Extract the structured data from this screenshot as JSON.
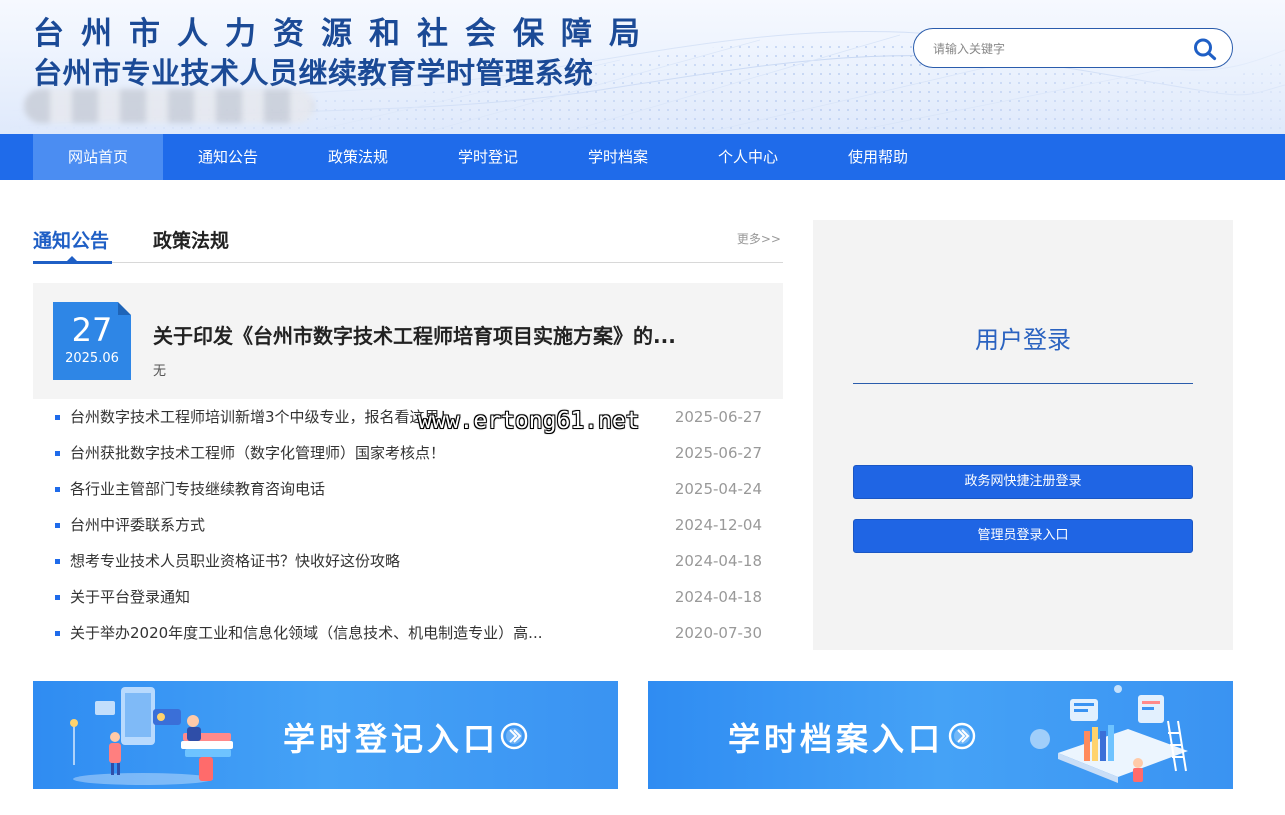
{
  "header": {
    "title_line1": "台州市人力资源和社会保障局",
    "title_line2": "台州市专业技术人员继续教育学时管理系统",
    "search_placeholder": "请输入关键字",
    "search_icon": "search-icon"
  },
  "nav": {
    "items": [
      {
        "label": "网站首页",
        "active": true
      },
      {
        "label": "通知公告"
      },
      {
        "label": "政策法规"
      },
      {
        "label": "学时登记"
      },
      {
        "label": "学时档案"
      },
      {
        "label": "个人中心"
      },
      {
        "label": "使用帮助"
      }
    ]
  },
  "news": {
    "tabs": [
      "通知公告",
      "政策法规"
    ],
    "more": "更多>>",
    "featured": {
      "day": "27",
      "year_month": "2025.06",
      "title": "关于印发《台州市数字技术工程师培育项目实施方案》的...",
      "subtitle": "无"
    },
    "items": [
      {
        "title": "台州数字技术工程师培训新增3个中级专业，报名看这里！",
        "date": "2025-06-27"
      },
      {
        "title": "台州获批数字技术工程师（数字化管理师）国家考核点！",
        "date": "2025-06-27"
      },
      {
        "title": "各行业主管部门专技继续教育咨询电话",
        "date": "2025-04-24"
      },
      {
        "title": "台州中评委联系方式",
        "date": "2024-12-04"
      },
      {
        "title": "想考专业技术人员职业资格证书？快收好这份攻略",
        "date": "2024-04-18"
      },
      {
        "title": "关于平台登录通知",
        "date": "2024-04-18"
      },
      {
        "title": "关于举办2020年度工业和信息化领域（信息技术、机电制造专业）高...",
        "date": "2020-07-30"
      }
    ]
  },
  "watermark": "www.ertong61.net",
  "login": {
    "title": "用户登录",
    "button_gov": "政务网快捷注册登录",
    "button_admin": "管理员登录入口"
  },
  "banners": {
    "register": "学时登记入口",
    "archive": "学时档案入口"
  },
  "colors": {
    "nav_bg": "#1f6bea",
    "nav_active": "#4b8df2",
    "title": "#1b4a96",
    "accent": "#1f5fc5",
    "date_box": "#2e86e6",
    "banner": "#3a93f2"
  }
}
